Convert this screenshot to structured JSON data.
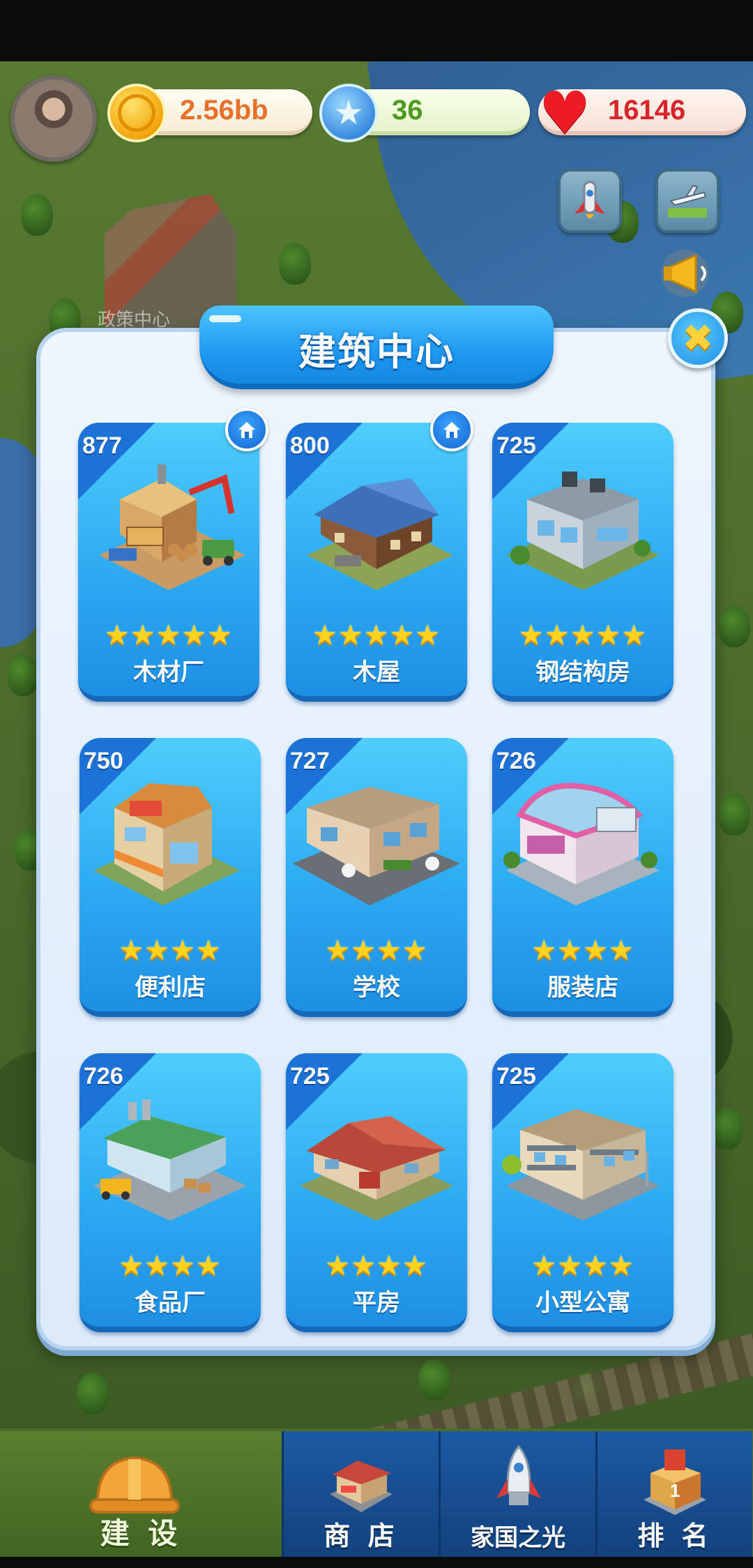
{
  "top_bar": {
    "coins": "2.56bb",
    "stars": "36",
    "hearts": "16146",
    "coin_color": "#e8702a",
    "star_color": "#4d9b1c",
    "heart_color": "#d8242a"
  },
  "background": {
    "building_label": "政策中心"
  },
  "panel": {
    "title": "建筑中心",
    "close_icon": "✖"
  },
  "buildings": [
    {
      "score": "877",
      "name": "木材厂",
      "stars": "★★★★★",
      "has_home": true
    },
    {
      "score": "800",
      "name": "木屋",
      "stars": "★★★★★",
      "has_home": true
    },
    {
      "score": "725",
      "name": "钢结构房",
      "stars": "★★★★★",
      "has_home": false
    },
    {
      "score": "750",
      "name": "便利店",
      "stars": "★★★★",
      "has_home": false
    },
    {
      "score": "727",
      "name": "学校",
      "stars": "★★★★",
      "has_home": false
    },
    {
      "score": "726",
      "name": "服装店",
      "stars": "★★★★",
      "has_home": false
    },
    {
      "score": "726",
      "name": "食品厂",
      "stars": "★★★★",
      "has_home": false
    },
    {
      "score": "725",
      "name": "平房",
      "stars": "★★★★",
      "has_home": false
    },
    {
      "score": "725",
      "name": "小型公寓",
      "stars": "★★★★",
      "has_home": false
    }
  ],
  "bottom_nav": {
    "items": [
      {
        "label": "建 设",
        "icon": "hard-hat-icon",
        "active": true
      },
      {
        "label": "商 店",
        "icon": "shop-icon",
        "active": false
      },
      {
        "label": "家国之光",
        "icon": "rocket-icon",
        "active": false
      },
      {
        "label": "排 名",
        "icon": "ranking-icon",
        "active": false
      }
    ]
  }
}
